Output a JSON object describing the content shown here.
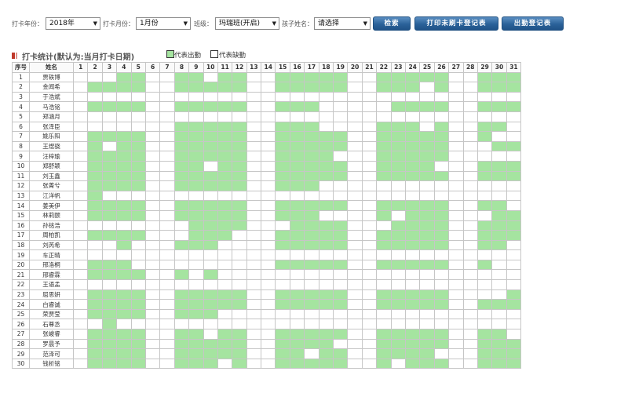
{
  "filters": {
    "year_label": "打卡年份：",
    "year_value": "2018年",
    "month_label": "打卡月份：",
    "month_value": "1月份",
    "class_label": "班级：",
    "class_value": "玛瑞班(开启)",
    "child_label": "孩子姓名：",
    "child_value": "请选择"
  },
  "buttons": {
    "search": "检索",
    "print_missing": "打印未刷卡登记表",
    "attendance_register": "出勤登记表"
  },
  "section": {
    "title": "打卡统计(默认为:当月打卡日期)",
    "legend_present": "代表出勤",
    "legend_absent": "代表缺勤"
  },
  "colors": {
    "present": "#a5e4a0",
    "absent": "#ffffff",
    "button": "#2b6299",
    "section_mark": "#c0392b"
  },
  "table": {
    "headers": [
      "序号",
      "姓名",
      "1",
      "2",
      "3",
      "4",
      "5",
      "6",
      "7",
      "8",
      "9",
      "10",
      "11",
      "12",
      "13",
      "14",
      "15",
      "16",
      "17",
      "18",
      "19",
      "20",
      "21",
      "22",
      "23",
      "24",
      "25",
      "26",
      "27",
      "28",
      "29",
      "30",
      "31"
    ],
    "rows": [
      {
        "no": "1",
        "name": "贾轶博",
        "days": [
          0,
          0,
          0,
          1,
          1,
          0,
          0,
          1,
          1,
          0,
          1,
          1,
          0,
          0,
          1,
          1,
          1,
          1,
          1,
          0,
          0,
          1,
          1,
          1,
          1,
          1,
          0,
          0,
          1,
          1,
          1
        ]
      },
      {
        "no": "2",
        "name": "金闻希",
        "days": [
          0,
          1,
          1,
          1,
          1,
          0,
          0,
          1,
          1,
          1,
          1,
          1,
          0,
          0,
          1,
          1,
          1,
          1,
          1,
          0,
          0,
          1,
          1,
          1,
          0,
          1,
          0,
          0,
          1,
          1,
          1
        ]
      },
      {
        "no": "3",
        "name": "于浩斌",
        "days": [
          0,
          0,
          0,
          0,
          0,
          0,
          0,
          0,
          0,
          0,
          0,
          0,
          0,
          0,
          0,
          0,
          0,
          0,
          0,
          0,
          0,
          0,
          0,
          0,
          0,
          0,
          0,
          0,
          0,
          0,
          0
        ]
      },
      {
        "no": "4",
        "name": "马浩铭",
        "days": [
          0,
          1,
          1,
          1,
          1,
          0,
          0,
          1,
          1,
          1,
          1,
          1,
          0,
          0,
          1,
          1,
          1,
          0,
          0,
          0,
          0,
          0,
          1,
          1,
          1,
          1,
          0,
          0,
          1,
          1,
          1
        ]
      },
      {
        "no": "5",
        "name": "郑涵月",
        "days": [
          0,
          0,
          0,
          0,
          0,
          0,
          0,
          0,
          0,
          0,
          0,
          0,
          0,
          0,
          0,
          0,
          0,
          0,
          0,
          0,
          0,
          0,
          0,
          0,
          0,
          0,
          0,
          0,
          0,
          0,
          0
        ]
      },
      {
        "no": "6",
        "name": "张泽臣",
        "days": [
          0,
          0,
          0,
          0,
          0,
          0,
          0,
          1,
          1,
          1,
          1,
          1,
          0,
          0,
          1,
          1,
          1,
          0,
          0,
          0,
          0,
          1,
          1,
          1,
          0,
          1,
          0,
          0,
          1,
          1,
          0
        ]
      },
      {
        "no": "7",
        "name": "姚乐阳",
        "days": [
          0,
          1,
          1,
          1,
          1,
          0,
          0,
          1,
          1,
          1,
          1,
          1,
          0,
          0,
          1,
          1,
          1,
          1,
          1,
          0,
          0,
          1,
          1,
          1,
          1,
          1,
          0,
          0,
          1,
          0,
          0
        ]
      },
      {
        "no": "8",
        "name": "王煜骁",
        "days": [
          0,
          1,
          0,
          1,
          1,
          0,
          0,
          1,
          1,
          1,
          1,
          1,
          0,
          0,
          1,
          1,
          1,
          1,
          1,
          0,
          0,
          1,
          1,
          1,
          1,
          1,
          0,
          0,
          0,
          1,
          1
        ]
      },
      {
        "no": "9",
        "name": "汪梓瑜",
        "days": [
          0,
          1,
          1,
          1,
          1,
          0,
          0,
          1,
          1,
          1,
          1,
          1,
          0,
          0,
          1,
          1,
          1,
          1,
          0,
          0,
          0,
          1,
          1,
          1,
          1,
          1,
          0,
          0,
          0,
          0,
          0
        ]
      },
      {
        "no": "10",
        "name": "郑舒颖",
        "days": [
          0,
          1,
          1,
          1,
          1,
          0,
          0,
          1,
          1,
          0,
          1,
          1,
          0,
          0,
          1,
          1,
          1,
          1,
          1,
          0,
          0,
          1,
          1,
          1,
          1,
          0,
          0,
          0,
          1,
          1,
          1
        ]
      },
      {
        "no": "11",
        "name": "刘玉鑫",
        "days": [
          0,
          1,
          1,
          1,
          1,
          0,
          0,
          1,
          1,
          1,
          1,
          1,
          0,
          0,
          1,
          1,
          1,
          1,
          1,
          0,
          0,
          1,
          1,
          1,
          1,
          1,
          0,
          0,
          1,
          1,
          1
        ]
      },
      {
        "no": "12",
        "name": "张菁兮",
        "days": [
          0,
          1,
          1,
          1,
          1,
          0,
          0,
          1,
          1,
          1,
          1,
          1,
          0,
          0,
          1,
          1,
          1,
          0,
          0,
          0,
          0,
          0,
          0,
          0,
          0,
          0,
          0,
          0,
          0,
          0,
          0
        ]
      },
      {
        "no": "13",
        "name": "江洋帆",
        "days": [
          0,
          1,
          0,
          0,
          0,
          0,
          0,
          0,
          0,
          0,
          0,
          0,
          0,
          0,
          0,
          0,
          0,
          0,
          0,
          0,
          0,
          0,
          0,
          0,
          0,
          0,
          0,
          0,
          0,
          0,
          0
        ]
      },
      {
        "no": "14",
        "name": "姜美伊",
        "days": [
          0,
          1,
          1,
          1,
          1,
          0,
          0,
          1,
          1,
          1,
          1,
          1,
          0,
          0,
          1,
          1,
          1,
          1,
          1,
          0,
          0,
          1,
          1,
          1,
          1,
          1,
          0,
          0,
          1,
          1,
          0
        ]
      },
      {
        "no": "15",
        "name": "林莉颐",
        "days": [
          0,
          1,
          1,
          1,
          1,
          0,
          0,
          1,
          1,
          1,
          1,
          1,
          0,
          0,
          1,
          1,
          1,
          0,
          0,
          0,
          0,
          1,
          0,
          1,
          1,
          1,
          0,
          0,
          0,
          1,
          1
        ]
      },
      {
        "no": "16",
        "name": "孙铭浩",
        "days": [
          0,
          0,
          0,
          0,
          0,
          0,
          0,
          0,
          1,
          1,
          1,
          1,
          0,
          0,
          0,
          1,
          1,
          1,
          1,
          0,
          0,
          0,
          1,
          1,
          1,
          1,
          0,
          0,
          1,
          1,
          1
        ]
      },
      {
        "no": "17",
        "name": "周柏凯",
        "days": [
          0,
          1,
          1,
          1,
          1,
          0,
          0,
          0,
          1,
          1,
          1,
          0,
          0,
          0,
          1,
          1,
          1,
          1,
          1,
          0,
          0,
          1,
          1,
          1,
          1,
          1,
          0,
          0,
          1,
          1,
          1
        ]
      },
      {
        "no": "18",
        "name": "刘芮希",
        "days": [
          0,
          0,
          0,
          1,
          0,
          0,
          0,
          1,
          1,
          1,
          0,
          0,
          0,
          0,
          1,
          1,
          1,
          1,
          1,
          0,
          0,
          1,
          1,
          1,
          1,
          1,
          0,
          0,
          1,
          1,
          0
        ]
      },
      {
        "no": "19",
        "name": "车正晴",
        "days": [
          0,
          0,
          0,
          0,
          0,
          0,
          0,
          0,
          0,
          0,
          0,
          0,
          0,
          0,
          0,
          0,
          0,
          0,
          0,
          0,
          0,
          0,
          0,
          0,
          0,
          0,
          0,
          0,
          0,
          0,
          0
        ]
      },
      {
        "no": "20",
        "name": "邢洛桐",
        "days": [
          0,
          1,
          1,
          1,
          0,
          0,
          0,
          0,
          0,
          0,
          0,
          0,
          0,
          0,
          1,
          1,
          1,
          1,
          1,
          0,
          0,
          1,
          1,
          1,
          1,
          1,
          0,
          0,
          1,
          0,
          0
        ]
      },
      {
        "no": "21",
        "name": "邢睿霖",
        "days": [
          0,
          1,
          1,
          1,
          1,
          0,
          0,
          1,
          0,
          1,
          0,
          0,
          0,
          0,
          0,
          0,
          0,
          0,
          0,
          0,
          0,
          0,
          0,
          0,
          0,
          0,
          0,
          0,
          0,
          0,
          0
        ]
      },
      {
        "no": "22",
        "name": "王语孟",
        "days": [
          0,
          0,
          0,
          0,
          0,
          0,
          0,
          0,
          0,
          0,
          0,
          0,
          0,
          0,
          0,
          0,
          0,
          0,
          0,
          0,
          0,
          0,
          0,
          0,
          0,
          0,
          0,
          0,
          0,
          0,
          0
        ]
      },
      {
        "no": "23",
        "name": "屈思妍",
        "days": [
          0,
          1,
          1,
          1,
          1,
          0,
          0,
          1,
          1,
          1,
          1,
          1,
          0,
          0,
          1,
          1,
          1,
          1,
          1,
          0,
          0,
          1,
          1,
          1,
          1,
          1,
          0,
          0,
          0,
          0,
          1
        ]
      },
      {
        "no": "24",
        "name": "白睿诚",
        "days": [
          0,
          1,
          1,
          1,
          1,
          0,
          0,
          1,
          1,
          1,
          1,
          1,
          0,
          0,
          1,
          1,
          1,
          1,
          1,
          0,
          0,
          1,
          1,
          1,
          1,
          1,
          0,
          0,
          1,
          1,
          1
        ]
      },
      {
        "no": "25",
        "name": "荣贾莹",
        "days": [
          0,
          1,
          1,
          1,
          1,
          0,
          0,
          1,
          1,
          1,
          0,
          0,
          0,
          0,
          0,
          0,
          0,
          0,
          0,
          0,
          0,
          0,
          0,
          0,
          0,
          0,
          0,
          0,
          0,
          0,
          0
        ]
      },
      {
        "no": "26",
        "name": "石尊丞",
        "days": [
          0,
          0,
          1,
          0,
          0,
          0,
          0,
          0,
          0,
          0,
          0,
          0,
          0,
          0,
          0,
          0,
          0,
          0,
          0,
          0,
          0,
          0,
          0,
          0,
          0,
          0,
          0,
          0,
          0,
          0,
          0
        ]
      },
      {
        "no": "27",
        "name": "张峻睿",
        "days": [
          0,
          1,
          1,
          1,
          1,
          0,
          0,
          1,
          1,
          0,
          1,
          1,
          0,
          0,
          1,
          1,
          1,
          1,
          1,
          0,
          0,
          1,
          1,
          1,
          1,
          1,
          0,
          0,
          1,
          1,
          0
        ]
      },
      {
        "no": "28",
        "name": "罗晨予",
        "days": [
          0,
          1,
          1,
          1,
          1,
          0,
          0,
          1,
          1,
          1,
          1,
          1,
          0,
          0,
          1,
          1,
          1,
          1,
          0,
          0,
          0,
          1,
          1,
          1,
          1,
          1,
          0,
          0,
          1,
          1,
          1
        ]
      },
      {
        "no": "29",
        "name": "范泽可",
        "days": [
          0,
          1,
          1,
          1,
          1,
          0,
          0,
          1,
          1,
          1,
          1,
          1,
          0,
          0,
          1,
          1,
          0,
          1,
          1,
          0,
          0,
          1,
          1,
          1,
          1,
          0,
          0,
          0,
          1,
          1,
          1
        ]
      },
      {
        "no": "30",
        "name": "钱析铭",
        "days": [
          0,
          1,
          1,
          1,
          1,
          0,
          0,
          1,
          1,
          1,
          0,
          1,
          0,
          0,
          1,
          1,
          1,
          1,
          1,
          0,
          0,
          1,
          0,
          1,
          1,
          1,
          0,
          0,
          1,
          1,
          1
        ]
      }
    ]
  }
}
